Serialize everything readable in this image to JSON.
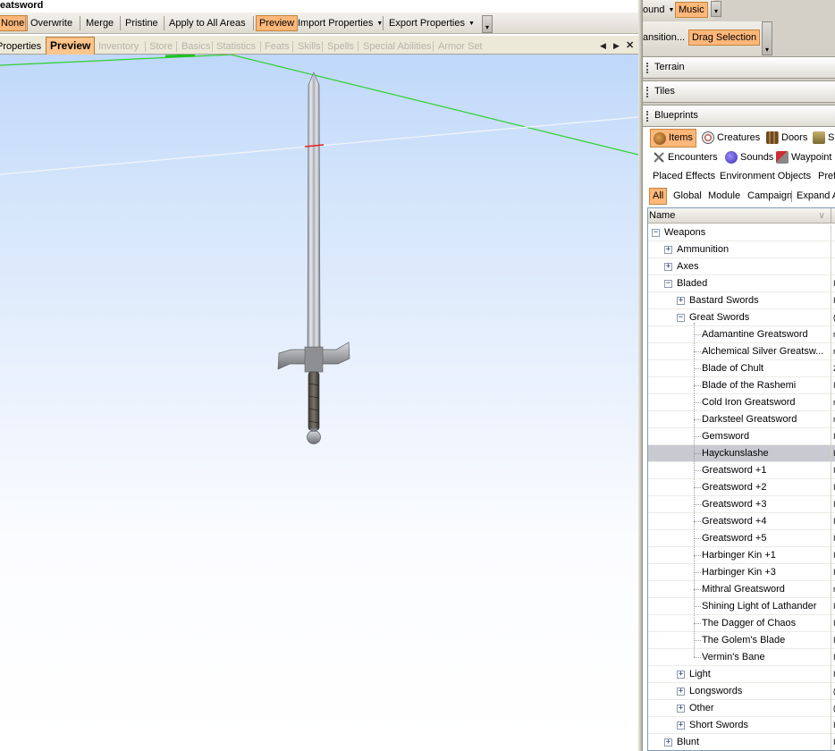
{
  "window": {
    "title": "eatsword"
  },
  "toolbar": {
    "items": [
      {
        "label": "None",
        "active": true
      },
      {
        "label": "Overwrite"
      },
      {
        "label": "Merge"
      },
      {
        "label": "Pristine"
      },
      {
        "label": "Apply to All Areas"
      },
      {
        "label": "Preview",
        "active": true
      },
      {
        "label": "Import Properties",
        "dropdown": true
      },
      {
        "label": "Export Properties",
        "dropdown": true
      }
    ]
  },
  "tabs": [
    {
      "label": "Properties",
      "state": "enabled"
    },
    {
      "label": "Preview",
      "state": "active"
    },
    {
      "label": "Inventory",
      "state": "disabled"
    },
    {
      "label": "Store",
      "state": "disabled"
    },
    {
      "label": "Basics",
      "state": "disabled"
    },
    {
      "label": "Statistics",
      "state": "disabled"
    },
    {
      "label": "Feats",
      "state": "disabled"
    },
    {
      "label": "Skills",
      "state": "disabled"
    },
    {
      "label": "Spells",
      "state": "disabled"
    },
    {
      "label": "Special Abilities",
      "state": "disabled"
    },
    {
      "label": "Armor Set",
      "state": "disabled"
    }
  ],
  "tab_nav": {
    "prev": "◀",
    "next": "▶",
    "close": "✕"
  },
  "right_toolbar": {
    "row1": [
      {
        "label": "ound",
        "dropdown": true
      },
      {
        "label": "Music",
        "active": true
      }
    ],
    "row2": [
      {
        "label": "ansition..."
      },
      {
        "label": "Drag Selection",
        "active": true
      }
    ]
  },
  "sections": {
    "terrain": "Terrain",
    "tiles": "Tiles",
    "blueprints": "Blueprints"
  },
  "blueprint_types": {
    "row1": [
      {
        "label": "Items",
        "icon": "items-icon",
        "active": true
      },
      {
        "label": "Creatures",
        "icon": "creatures-icon"
      },
      {
        "label": "Doors",
        "icon": "doors-icon"
      },
      {
        "label": "SU",
        "icon": "su-icon"
      }
    ],
    "row2": [
      {
        "label": "Encounters",
        "icon": "encounters-icon"
      },
      {
        "label": "Sounds",
        "icon": "sounds-icon"
      },
      {
        "label": "Waypoint",
        "icon": "waypoint-icon"
      }
    ],
    "row3": [
      {
        "label": "Placed Effects"
      },
      {
        "label": "Environment Objects"
      },
      {
        "label": "Prefa"
      }
    ]
  },
  "filters": [
    {
      "label": "All",
      "active": true
    },
    {
      "label": "Global"
    },
    {
      "label": "Module"
    },
    {
      "label": "Campaign"
    },
    {
      "label": "Expand A"
    }
  ],
  "tree": {
    "header": {
      "name": "Name",
      "sort_icon": "\\/"
    },
    "rows": [
      {
        "label": "Weapons",
        "level": 0,
        "expander": "−",
        "value": ""
      },
      {
        "label": "Ammunition",
        "level": 1,
        "expander": "+",
        "value": ""
      },
      {
        "label": "Axes",
        "level": 1,
        "expander": "+",
        "value": ""
      },
      {
        "label": "Bladed",
        "level": 1,
        "expander": "−",
        "value": "I"
      },
      {
        "label": "Bastard Swords",
        "level": 2,
        "expander": "+",
        "value": "I"
      },
      {
        "label": "Great Swords",
        "level": 2,
        "expander": "−",
        "value": "("
      },
      {
        "label": "Adamantine Greatsword",
        "level": 3,
        "value": "r"
      },
      {
        "label": "Alchemical Silver Greatsw...",
        "level": 3,
        "value": "r"
      },
      {
        "label": "Blade of Chult",
        "level": 3,
        "value": "2"
      },
      {
        "label": "Blade of the Rashemi",
        "level": 3,
        "value": "I"
      },
      {
        "label": "Cold Iron Greatsword",
        "level": 3,
        "value": "r"
      },
      {
        "label": "Darksteel Greatsword",
        "level": 3,
        "value": "r"
      },
      {
        "label": "Gemsword",
        "level": 3,
        "value": "I"
      },
      {
        "label": "Hayckunslashe",
        "level": 3,
        "value": "I",
        "selected": true
      },
      {
        "label": "Greatsword +1",
        "level": 3,
        "value": "I"
      },
      {
        "label": "Greatsword +2",
        "level": 3,
        "value": "I"
      },
      {
        "label": "Greatsword +3",
        "level": 3,
        "value": "I"
      },
      {
        "label": "Greatsword +4",
        "level": 3,
        "value": "I"
      },
      {
        "label": "Greatsword +5",
        "level": 3,
        "value": "I"
      },
      {
        "label": "Harbinger Kin +1",
        "level": 3,
        "value": "I"
      },
      {
        "label": "Harbinger Kin +3",
        "level": 3,
        "value": "I"
      },
      {
        "label": "Mithral Greatsword",
        "level": 3,
        "value": "r"
      },
      {
        "label": "Shining Light of Lathander",
        "level": 3,
        "value": "I"
      },
      {
        "label": "The Dagger of Chaos",
        "level": 3,
        "value": "I"
      },
      {
        "label": "The Golem's Blade",
        "level": 3,
        "value": "I"
      },
      {
        "label": "Vermin's Bane",
        "level": 3,
        "value": "I"
      },
      {
        "label": "Light",
        "level": 2,
        "expander": "+",
        "value": "I"
      },
      {
        "label": "Longswords",
        "level": 2,
        "expander": "+",
        "value": "("
      },
      {
        "label": "Other",
        "level": 2,
        "expander": "+",
        "value": "("
      },
      {
        "label": "Short Swords",
        "level": 2,
        "expander": "+",
        "value": "I"
      },
      {
        "label": "Blunt",
        "level": 1,
        "expander": "+",
        "value": "I"
      }
    ]
  }
}
